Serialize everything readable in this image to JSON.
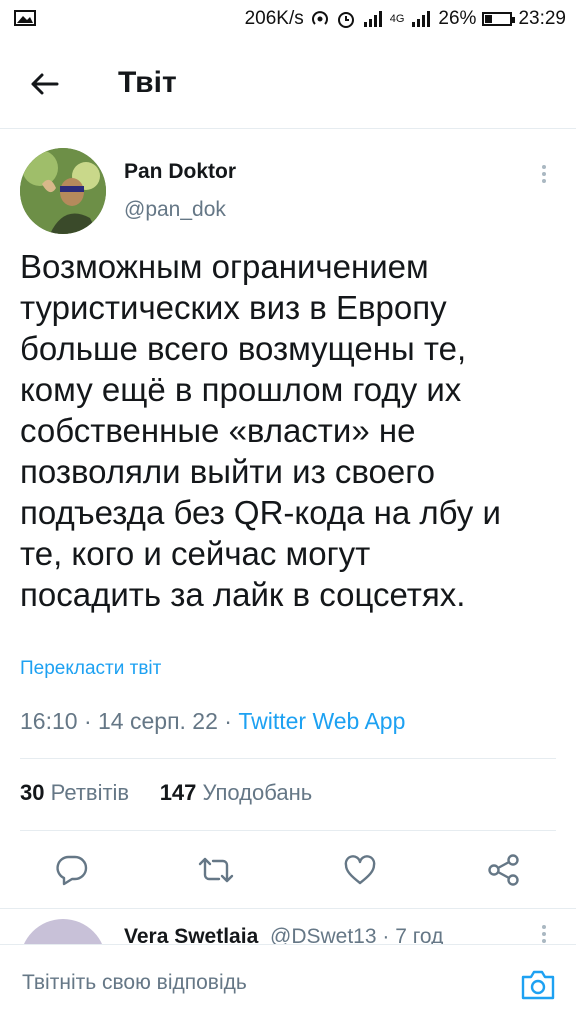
{
  "status_bar": {
    "speed": "206K/s",
    "battery": "26%",
    "battery_level": 0.26,
    "time": "23:29",
    "network": "4G"
  },
  "header": {
    "title": "Твіт",
    "back_icon": "arrow-left-icon"
  },
  "tweet": {
    "author_name": "Pan Doktor",
    "author_handle": "@pan_dok",
    "text": "Возможным ограничением\nтуристических виз в Европу\nбольше всего возмущены те,\nкому ещё в прошлом году их\nсобственные «власти» не\nпозволяли выйти из своего\nподъезда без QR-кода на лбу и\nте, кого и сейчас могут\nпосадить за лайк в соцсетях.",
    "translate_label": "Перекласти твіт",
    "time": "16:10",
    "sep1": " · ",
    "date": "14 серп. 22",
    "sep2": " · ",
    "source": "Twitter Web App",
    "retweets_count": "30",
    "retweets_label": "Ретвітів",
    "likes_count": "147",
    "likes_label": "Уподобань"
  },
  "reply_preview": {
    "name": "Vera Swetlaia",
    "handle": "@DSwet13 · 7 год"
  },
  "compose": {
    "placeholder": "Твітніть свою відповідь"
  },
  "colors": {
    "accent": "#1da1f2",
    "secondary_text": "#657786",
    "divider": "#e6ecf0"
  }
}
